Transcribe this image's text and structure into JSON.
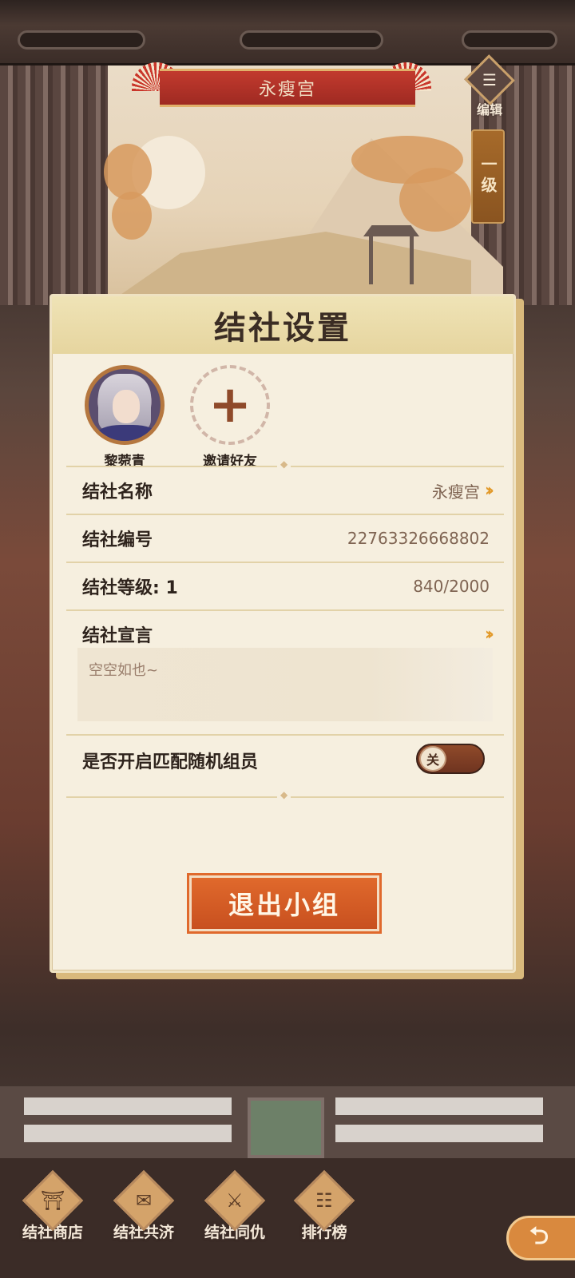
{
  "header": {
    "title": "永瘦宫",
    "edit_label": "编辑",
    "edit_icon_glyph": "☰",
    "level_tag": "一级"
  },
  "dialog": {
    "title": "结社设置",
    "members": [
      {
        "name": "黎菀青"
      },
      {
        "name": "邀请好友",
        "icon": "plus-icon"
      }
    ],
    "rows": {
      "name": {
        "label": "结社名称",
        "value": "永瘦宫"
      },
      "id": {
        "label": "结社编号",
        "value": "22763326668802"
      },
      "level": {
        "label": "结社等级: 1",
        "value": "840/2000"
      },
      "declaration": {
        "label": "结社宣言",
        "text": "空空如也~"
      },
      "random_match": {
        "label": "是否开启匹配随机组员",
        "toggle_text": "关",
        "enabled": false
      }
    },
    "chevron": "››",
    "exit_button": "退出小组"
  },
  "bottom_nav": [
    {
      "label": "结社商店",
      "icon": "shop-icon",
      "glyph": "⛩"
    },
    {
      "label": "结社共济",
      "icon": "scroll-icon",
      "glyph": "✉"
    },
    {
      "label": "结社同仇",
      "icon": "sword-icon",
      "glyph": "⚔"
    },
    {
      "label": "排行榜",
      "icon": "ranking-icon",
      "glyph": "☷"
    }
  ],
  "back_glyph": "⮌",
  "colors": {
    "accent_orange": "#d9612a",
    "banner_red": "#b3322a",
    "panel_bg": "#f6efdf",
    "chevron": "#e29a2a"
  }
}
